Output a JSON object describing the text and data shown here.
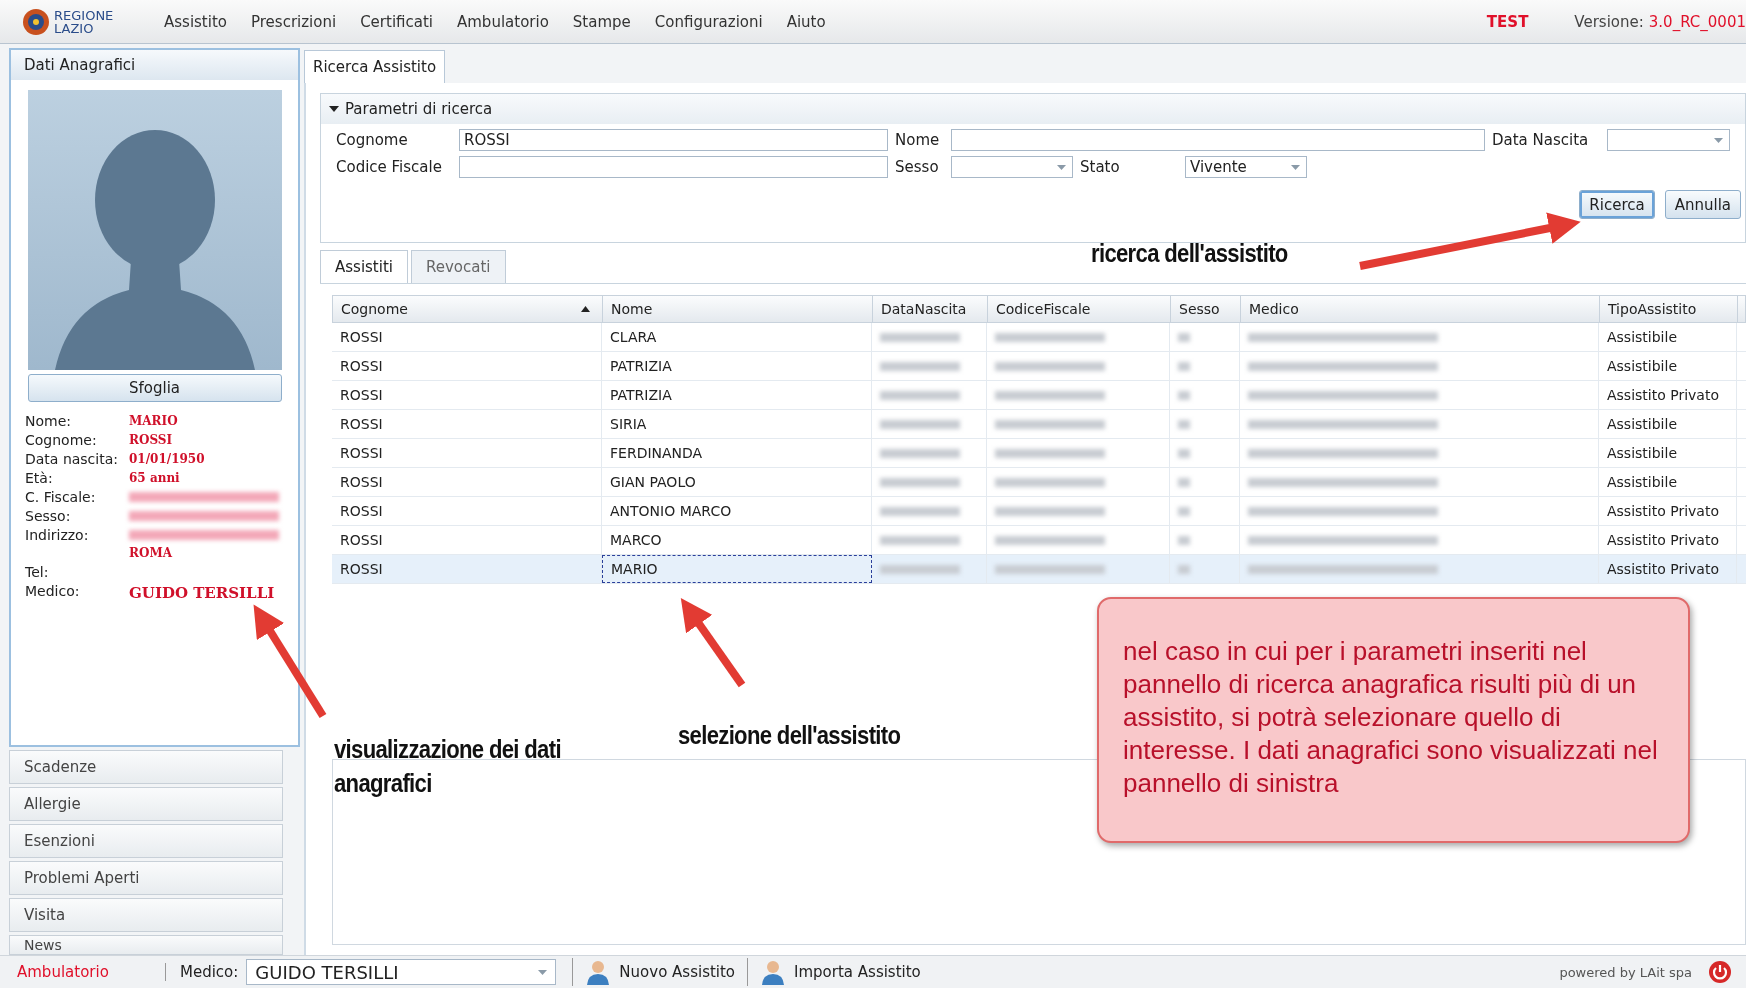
{
  "menu_bar": {
    "logo": [
      "REGIONE",
      "LAZIO"
    ],
    "items": [
      "Assistito",
      "Prescrizioni",
      "Certificati",
      "Ambulatorio",
      "Stampe",
      "Configurazioni",
      "Aiuto"
    ],
    "environment": "TEST",
    "version_label": "Versione:",
    "version": "3.0_RC_0001"
  },
  "patient_panel": {
    "title": "Dati Anagrafici",
    "browse_button": "Sfoglia",
    "fields": [
      {
        "label": "Nome:",
        "value": "MARIO",
        "kind": "plain"
      },
      {
        "label": "Cognome:",
        "value": "ROSSI",
        "kind": "plain"
      },
      {
        "label": "Data nascita:",
        "value": "01/01/1950",
        "kind": "plain"
      },
      {
        "label": "Età:",
        "value": "65 anni",
        "kind": "plain"
      },
      {
        "label": "C. Fiscale:",
        "kind": "redacted"
      },
      {
        "label": "Sesso:",
        "kind": "redacted"
      },
      {
        "label": "Indirizzo:",
        "value": "ROMA",
        "kind": "redacted"
      },
      {
        "label": "Tel:",
        "kind": "plain"
      },
      {
        "label": "Medico:",
        "value": "GUIDO TERSILLI",
        "kind": "large"
      }
    ]
  },
  "sidebar": {
    "items": [
      "Scadenze",
      "Allergie",
      "Esenzioni",
      "Problemi Aperti",
      "Visita",
      "News"
    ]
  },
  "main_tab": {
    "label": "Ricerca Assistito",
    "selected": true
  },
  "search": {
    "title": "Parametri di ricerca",
    "expanded": true,
    "row_1": [
      {
        "label": "Cognome",
        "kind": "text",
        "value": "ROSSI"
      },
      {
        "label": "Nome",
        "kind": "text"
      },
      {
        "label": "Data Nascita",
        "kind": "dropdown"
      }
    ],
    "row_2": [
      {
        "label": "Codice Fiscale",
        "kind": "text"
      },
      {
        "label": "Sesso",
        "kind": "dropdown"
      },
      {
        "label": "Stato",
        "kind": "dropdown",
        "value": "Vivente"
      }
    ],
    "buttons": [
      {
        "label": "Ricerca",
        "focused": true
      },
      {
        "label": "Annulla",
        "focused": false
      }
    ]
  },
  "result_tabs": [
    {
      "label": "Assistiti",
      "selected": true
    },
    {
      "label": "Revocati",
      "selected": false
    }
  ],
  "table": {
    "columns": [
      {
        "label": "Cognome",
        "sorted": true
      },
      {
        "label": "Nome",
        "sorted": false
      },
      {
        "label": "DataNascita",
        "sorted": false
      },
      {
        "label": "CodiceFiscale",
        "sorted": false
      },
      {
        "label": "Sesso",
        "sorted": false
      },
      {
        "label": "Medico",
        "sorted": false
      },
      {
        "label": "TipoAssistito",
        "sorted": false
      }
    ],
    "rows": [
      {
        "cognome": "ROSSI",
        "nome": "CLARA",
        "tipo": "Assistibile",
        "selected": false
      },
      {
        "cognome": "ROSSI",
        "nome": "PATRIZIA",
        "tipo": "Assistibile",
        "selected": false
      },
      {
        "cognome": "ROSSI",
        "nome": "PATRIZIA",
        "tipo": "Assistito Privato",
        "selected": false
      },
      {
        "cognome": "ROSSI",
        "nome": "SIRIA",
        "tipo": "Assistibile",
        "selected": false
      },
      {
        "cognome": "ROSSI",
        "nome": "FERDINANDA",
        "tipo": "Assistibile",
        "selected": false
      },
      {
        "cognome": "ROSSI",
        "nome": "GIAN PAOLO",
        "tipo": "Assistibile",
        "selected": false
      },
      {
        "cognome": "ROSSI",
        "nome": "ANTONIO MARCO",
        "tipo": "Assistito Privato",
        "selected": false
      },
      {
        "cognome": "ROSSI",
        "nome": "MARCO",
        "tipo": "Assistito Privato",
        "selected": false
      },
      {
        "cognome": "ROSSI",
        "nome": "MARIO",
        "tipo": "Assistito Privato",
        "selected": true
      }
    ]
  },
  "status_bar": {
    "section": "Ambulatorio",
    "doctor_label": "Medico:",
    "doctor": "GUIDO TERSILLI",
    "buttons": [
      "Nuovo Assistito",
      "Importa Assistito"
    ],
    "credit": "powered by LAit spa"
  },
  "annotations": {
    "search_note": "ricerca dell'assistito",
    "panel_note": "visualizzazione dei dati anagrafici",
    "select_note": "selezione dell'assistito",
    "callout": "nel caso in cui per i parametri inseriti nel pannello di ricerca anagrafica risulti più di un assistito, si potrà selezionare quello di interesse. I dati anagrafici sono visualizzati nel pannello di sinistra"
  }
}
